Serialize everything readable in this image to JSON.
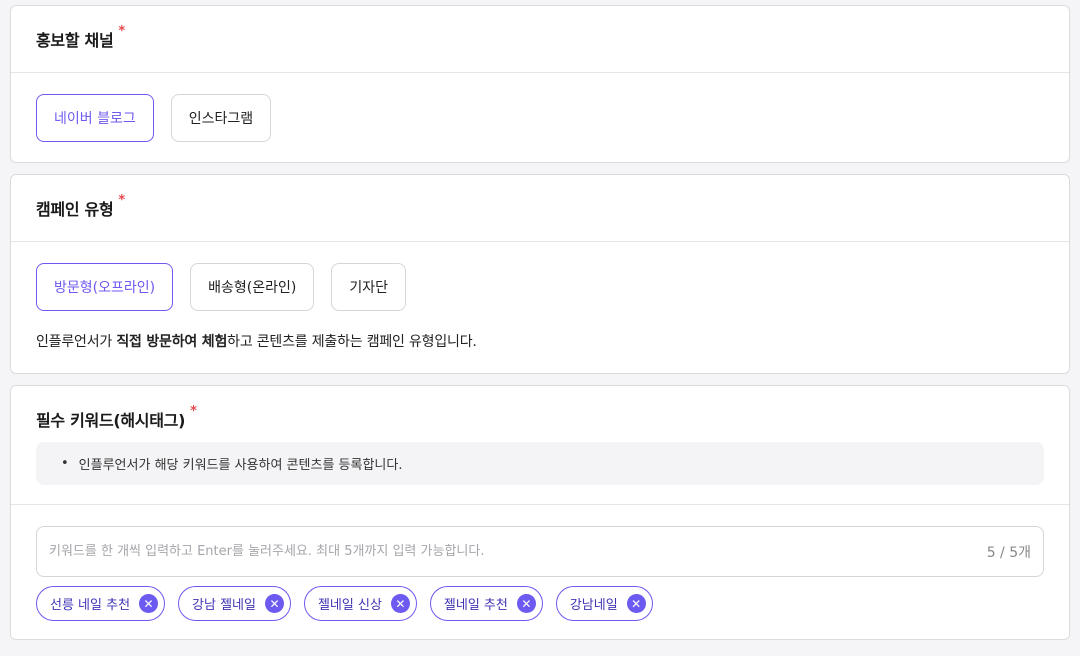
{
  "channel": {
    "title": "홍보할 채널",
    "required_mark": "*",
    "options": [
      {
        "label": "네이버 블로그",
        "selected": true
      },
      {
        "label": "인스타그램",
        "selected": false
      }
    ]
  },
  "campaign": {
    "title": "캠페인 유형",
    "required_mark": "*",
    "options": [
      {
        "label": "방문형(오프라인)",
        "selected": true
      },
      {
        "label": "배송형(온라인)",
        "selected": false
      },
      {
        "label": "기자단",
        "selected": false
      }
    ],
    "description": {
      "part1": "인플루언서가 ",
      "bold": "직접 방문하여 체험",
      "part2": "하고 콘텐츠를 제출하는 캠페인 유형입니다."
    }
  },
  "keywords": {
    "title": "필수 키워드(해시태그)",
    "required_mark": "*",
    "hint": "인플루언서가 해당 키워드를 사용하여 콘텐츠를 등록합니다.",
    "input_placeholder": "키워드를 한 개씩 입력하고 Enter를 눌러주세요. 최대 5개까지 입력 가능합니다.",
    "input_value": "",
    "count_text": "5 / 5개",
    "tags": [
      {
        "label": "선릉 네일 추천"
      },
      {
        "label": "강남 젤네일"
      },
      {
        "label": "젤네일 신상"
      },
      {
        "label": "젤네일 추천"
      },
      {
        "label": "강남네일"
      }
    ],
    "remove_glyph": "✕"
  },
  "theme": {
    "accent": "#6d5af0",
    "required": "#e5484d",
    "border": "#d6d6da"
  }
}
